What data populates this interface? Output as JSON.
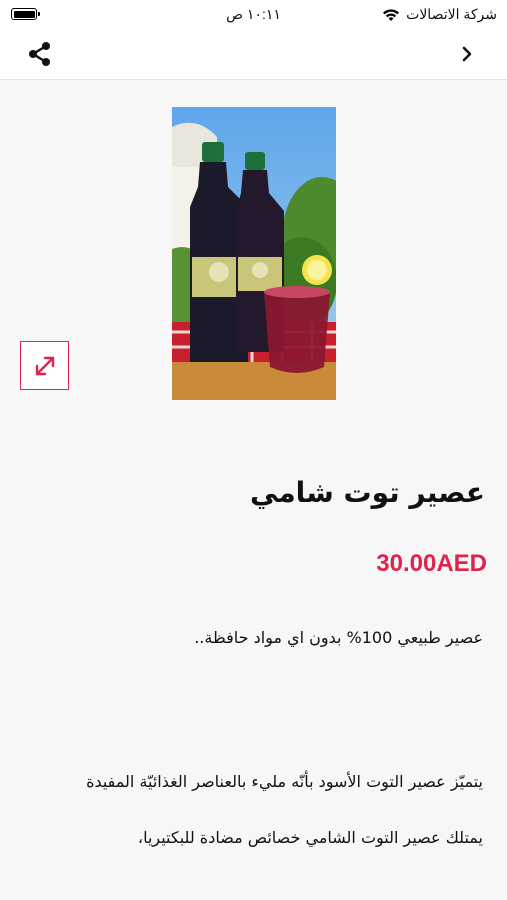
{
  "status_bar": {
    "time": "١٠:١١ ص",
    "carrier": "شركة الاتصالات"
  },
  "product": {
    "title": "عصير توت شامي",
    "price": "30.00AED",
    "description_line1": "عصير طبيعي 100% بدون اي مواد حافظة..",
    "description_line2": "يتميّز عصير التوت الأسود بأنّه مليء بالعناصر الغذائيّة المفيدة",
    "description_line3": "يمتلك عصير التوت الشامي خصائص مضادة للبكتيريا،"
  },
  "colors": {
    "accent": "#e0234d"
  }
}
